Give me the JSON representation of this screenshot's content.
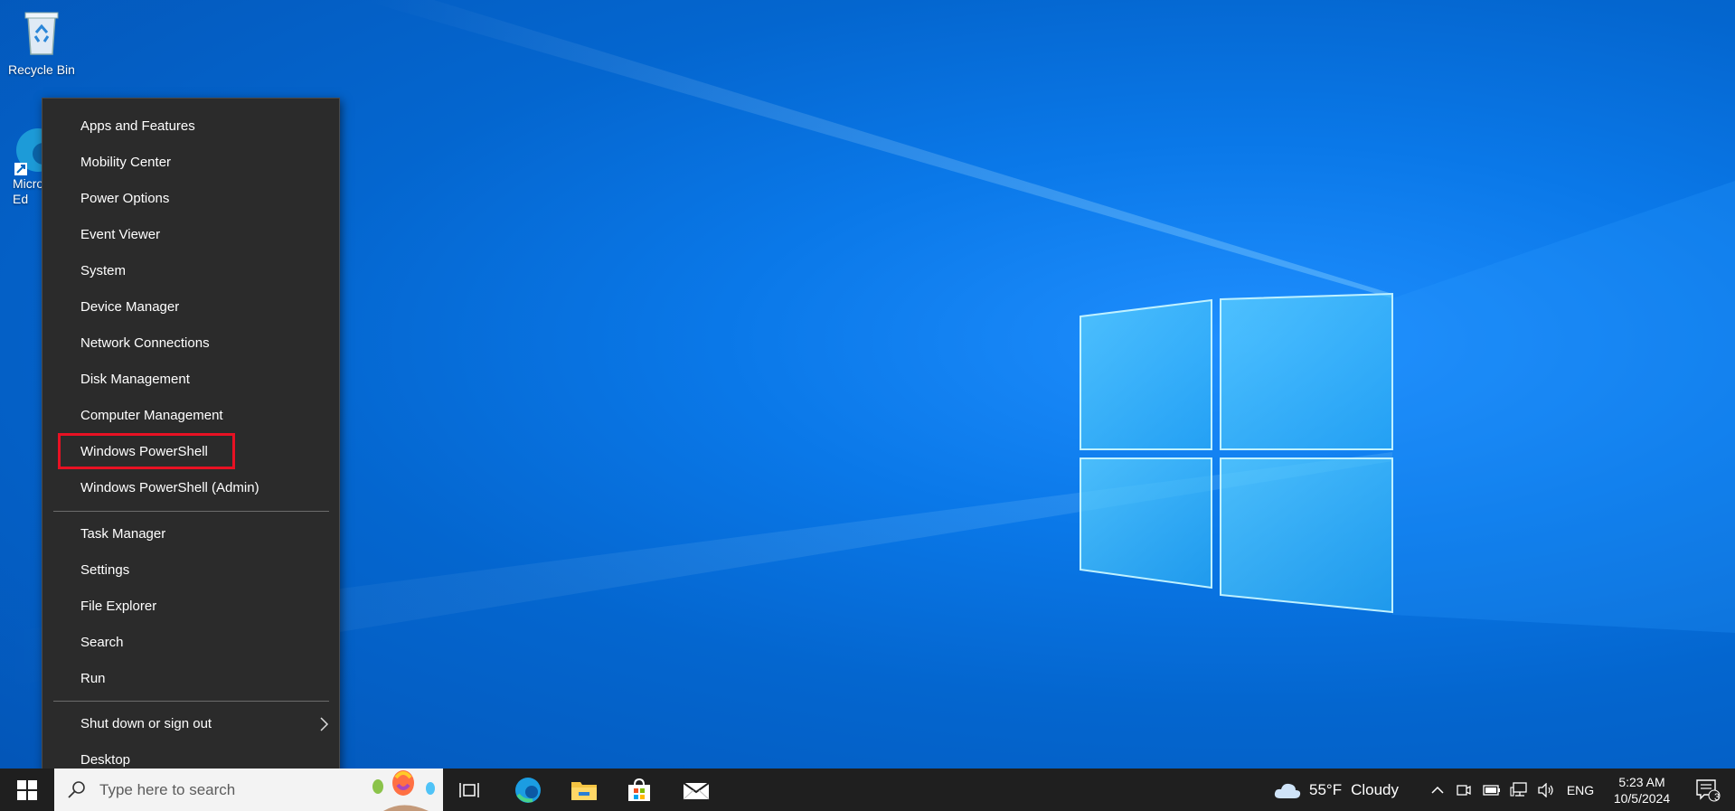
{
  "desktop": {
    "icons": [
      {
        "label": "Recycle Bin",
        "icon": "recycle-bin-icon"
      },
      {
        "label": "Micro… Ed",
        "icon": "edge-icon"
      }
    ]
  },
  "context_menu": {
    "items": [
      {
        "label": "Apps and Features"
      },
      {
        "label": "Mobility Center"
      },
      {
        "label": "Power Options"
      },
      {
        "label": "Event Viewer"
      },
      {
        "label": "System"
      },
      {
        "label": "Device Manager"
      },
      {
        "label": "Network Connections"
      },
      {
        "label": "Disk Management"
      },
      {
        "label": "Computer Management"
      },
      {
        "label": "Windows PowerShell",
        "highlighted": true
      },
      {
        "label": "Windows PowerShell (Admin)"
      },
      {
        "label": "Task Manager"
      },
      {
        "label": "Settings"
      },
      {
        "label": "File Explorer"
      },
      {
        "label": "Search"
      },
      {
        "label": "Run"
      },
      {
        "label": "Shut down or sign out",
        "has_submenu": true
      },
      {
        "label": "Desktop"
      }
    ],
    "highlight_color": "#e81123"
  },
  "taskbar": {
    "search_placeholder": "Type here to search",
    "pinned": [
      "task-view-icon",
      "edge-icon",
      "file-explorer-icon",
      "store-icon",
      "mail-icon"
    ],
    "weather": {
      "temp": "55°F",
      "condition": "Cloudy"
    },
    "language": "ENG",
    "time": "5:23 AM",
    "date": "10/5/2024",
    "notification_count": "3"
  }
}
